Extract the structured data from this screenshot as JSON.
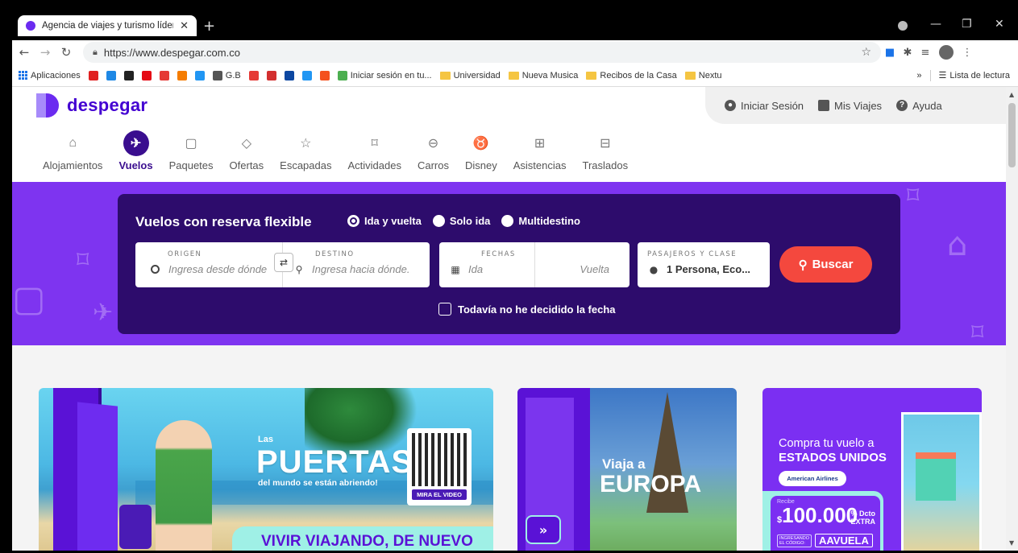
{
  "browser": {
    "tab_title": "Agencia de viajes y turismo líder",
    "url": "https://www.despegar.com.co",
    "bookmarks": [
      {
        "label": "Aplicaciones",
        "kind": "apps"
      },
      {
        "label": "",
        "kind": "icon",
        "color": "#e02020"
      },
      {
        "label": "",
        "kind": "icon",
        "color": "#1e88e5"
      },
      {
        "label": "",
        "kind": "icon",
        "color": "#222222"
      },
      {
        "label": "",
        "kind": "icon",
        "color": "#e50914"
      },
      {
        "label": "",
        "kind": "icon",
        "color": "#e53935"
      },
      {
        "label": "",
        "kind": "icon",
        "color": "#f57c00"
      },
      {
        "label": "",
        "kind": "icon",
        "color": "#2196f3"
      },
      {
        "label": "G.B",
        "kind": "icon",
        "color": "#555555"
      },
      {
        "label": "",
        "kind": "icon",
        "color": "#e53935"
      },
      {
        "label": "",
        "kind": "icon",
        "color": "#d32f2f"
      },
      {
        "label": "",
        "kind": "icon",
        "color": "#0d47a1"
      },
      {
        "label": "",
        "kind": "icon",
        "color": "#2196f3"
      },
      {
        "label": "",
        "kind": "icon",
        "color": "#f4511e"
      },
      {
        "label": "Iniciar sesión en tu...",
        "kind": "icon",
        "color": "#4caf50"
      },
      {
        "label": "Universidad",
        "kind": "folder"
      },
      {
        "label": "Nueva Musica",
        "kind": "folder"
      },
      {
        "label": "Recibos de la Casa",
        "kind": "folder"
      },
      {
        "label": "Nextu",
        "kind": "folder"
      }
    ],
    "overflow": "»",
    "reading_list": "Lista de lectura"
  },
  "header": {
    "logo_text": "despegar",
    "login": "Iniciar Sesión",
    "trips": "Mis Viajes",
    "help": "Ayuda"
  },
  "products": [
    {
      "label": "Alojamientos",
      "icon": "bed-icon",
      "glyph": "⌂",
      "active": false
    },
    {
      "label": "Vuelos",
      "icon": "plane-icon",
      "glyph": "✈",
      "active": true
    },
    {
      "label": "Paquetes",
      "icon": "suitcase-icon",
      "glyph": "▢",
      "active": false
    },
    {
      "label": "Ofertas",
      "icon": "tag-icon",
      "glyph": "◇",
      "active": false
    },
    {
      "label": "Escapadas",
      "icon": "star-icon",
      "glyph": "☆",
      "active": false
    },
    {
      "label": "Actividades",
      "icon": "ticket-icon",
      "glyph": "⌑",
      "active": false
    },
    {
      "label": "Carros",
      "icon": "car-icon",
      "glyph": "⊖",
      "active": false
    },
    {
      "label": "Disney",
      "icon": "mickey-icon",
      "glyph": "♉",
      "active": false
    },
    {
      "label": "Asistencias",
      "icon": "medkit-icon",
      "glyph": "⊞",
      "active": false
    },
    {
      "label": "Traslados",
      "icon": "bus-icon",
      "glyph": "⊟",
      "active": false
    }
  ],
  "search": {
    "title": "Vuelos con reserva flexible",
    "trip_types": [
      "Ida y vuelta",
      "Solo ida",
      "Multidestino"
    ],
    "selected_trip_type": "Ida y vuelta",
    "origin_label": "ORIGEN",
    "origin_placeholder": "Ingresa desde dónde...",
    "destination_label": "DESTINO",
    "destination_placeholder": "Ingresa hacia dónde...",
    "dates_label": "FECHAS",
    "depart_placeholder": "Ida",
    "return_placeholder": "Vuelta",
    "passengers_label": "PASAJEROS Y CLASE",
    "passengers_value": "1 Persona, Eco...",
    "search_button": "Buscar",
    "no_date_label": "Todavía no he decidido la fecha"
  },
  "banners": {
    "b1_small": "Las",
    "b1_big": "PUERTAS",
    "b1_sub": "del mundo se están abriendo!",
    "b1_qr_caption": "MIRA EL VIDEO",
    "b1_ribbon": "VIVIR VIAJANDO, DE NUEVO",
    "b2_small": "Viaja a",
    "b2_big": "EUROPA",
    "b2_arrow": "»",
    "b3_title_1": "Compra tu vuelo a",
    "b3_title_2": "ESTADOS UNIDOS",
    "b3_airline": "American Airlines",
    "b3_recibe": "Recibe",
    "b3_amount": "100.000",
    "b3_currency": "$",
    "b3_extra_1": "% Dcto",
    "b3_extra_2": "EXTRA",
    "b3_code_caption_1": "INGRESANDO",
    "b3_code_caption_2": "EL CÓDIGO:",
    "b3_code": "AAVUELA"
  }
}
